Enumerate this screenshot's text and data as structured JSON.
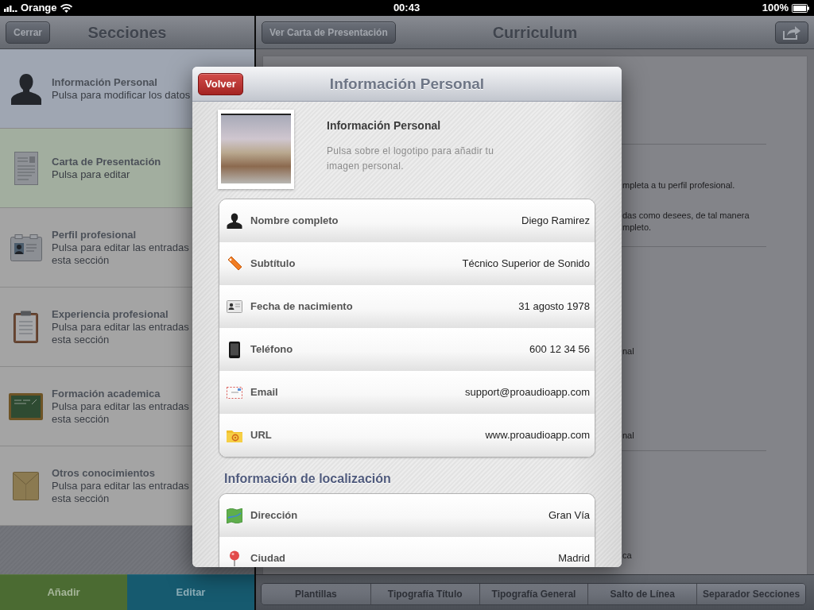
{
  "status_bar": {
    "carrier": "Orange",
    "time": "00:43",
    "battery": "100%"
  },
  "sections_panel": {
    "close_button": "Cerrar",
    "title": "Secciones",
    "items": [
      {
        "title": "Información Personal",
        "subtitle": [
          "Pulsa para modificar los datos"
        ],
        "color": "#9fa6b2"
      },
      {
        "title": "Carta de Presentación",
        "subtitle": [
          "Pulsa para editar"
        ],
        "color": "#a2ae9f"
      },
      {
        "title": "Perfil profesional",
        "subtitle": [
          "Pulsa para editar las entradas",
          "esta sección"
        ],
        "color": "#a4a4a4"
      },
      {
        "title": "Experiencia profesional",
        "subtitle": [
          "Pulsa para editar las entradas",
          "esta sección"
        ],
        "color": "#a4a4a4"
      },
      {
        "title": "Formación academica",
        "subtitle": [
          "Pulsa para editar las entradas",
          "esta sección"
        ],
        "color": "#a4a4a4"
      },
      {
        "title": "Otros conocimientos",
        "subtitle": [
          "Pulsa para editar las entradas",
          "esta sección"
        ],
        "color": "#a4a4a4"
      }
    ],
    "buttons": [
      {
        "label": "Añadir",
        "color": "#4b6b32"
      },
      {
        "label": "Editar",
        "color": "#165a6f"
      }
    ]
  },
  "curriculum_panel": {
    "left_button": "Ver Carta de Presentación",
    "title": "Curriculum",
    "document": [
      {
        "kind": "rule"
      },
      {
        "kind": "text",
        "text": "mpleta a tu perfil profesional."
      },
      {
        "kind": "text",
        "text": "das como desees, de tal manera"
      },
      {
        "kind": "text",
        "text": "mpleto."
      },
      {
        "kind": "rule"
      },
      {
        "kind": "text",
        "text": "nal"
      },
      {
        "kind": "text",
        "text": "nal"
      },
      {
        "kind": "rule"
      },
      {
        "kind": "text",
        "text": "ca"
      }
    ],
    "toolbar": [
      {
        "label": "Plantillas"
      },
      {
        "label": "Tipografía Título"
      },
      {
        "label": "Tipografía General"
      },
      {
        "label": "Salto de Línea"
      },
      {
        "label": "Separador Secciones"
      }
    ]
  },
  "dialog": {
    "back_button": "Volver",
    "title": "Información Personal",
    "profile": {
      "title": "Información Personal",
      "description": "Pulsa sobre el logotipo para añadir tu imagen personal."
    },
    "groups": [
      {
        "rows": [
          {
            "label": "Nombre completo",
            "value": "Diego Ramirez"
          },
          {
            "label": "Subtítulo",
            "value": "Técnico Superior de Sonido"
          },
          {
            "label": "Fecha de nacimiento",
            "value": "31 agosto 1978"
          },
          {
            "label": "Teléfono",
            "value": "600 12 34 56"
          },
          {
            "label": "Email",
            "value": "support@proaudioapp.com"
          },
          {
            "label": "URL",
            "value": "www.proaudioapp.com"
          }
        ]
      },
      {
        "title": "Información de localización",
        "rows": [
          {
            "label": "Dirección",
            "value": "Gran Vía"
          },
          {
            "label": "Ciudad",
            "value": "Madrid"
          }
        ]
      }
    ]
  }
}
